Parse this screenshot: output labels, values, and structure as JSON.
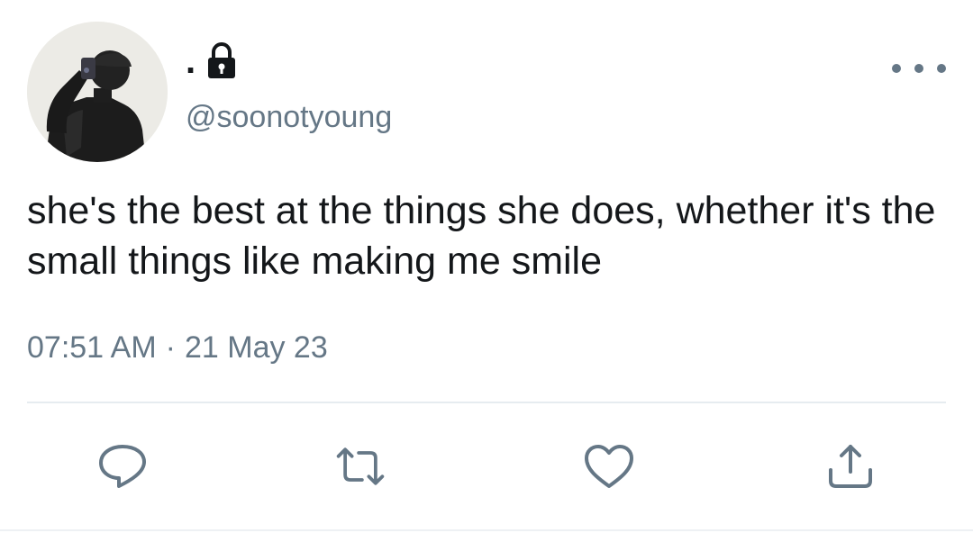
{
  "user": {
    "display_name": ".",
    "handle": "@soonotyoung",
    "protected": true
  },
  "tweet": {
    "text": "she's the best at the things she does, whether it's the small things like making me smile",
    "time": "07:51 AM",
    "separator": "·",
    "date": "21 May 23"
  },
  "icons": {
    "lock": "lock-icon",
    "more": "more-horizontal-icon",
    "reply": "reply-icon",
    "retweet": "retweet-icon",
    "like": "heart-icon",
    "share": "share-icon"
  },
  "colors": {
    "text": "#14171a",
    "secondary": "#657786",
    "divider": "#e6ecf0"
  }
}
